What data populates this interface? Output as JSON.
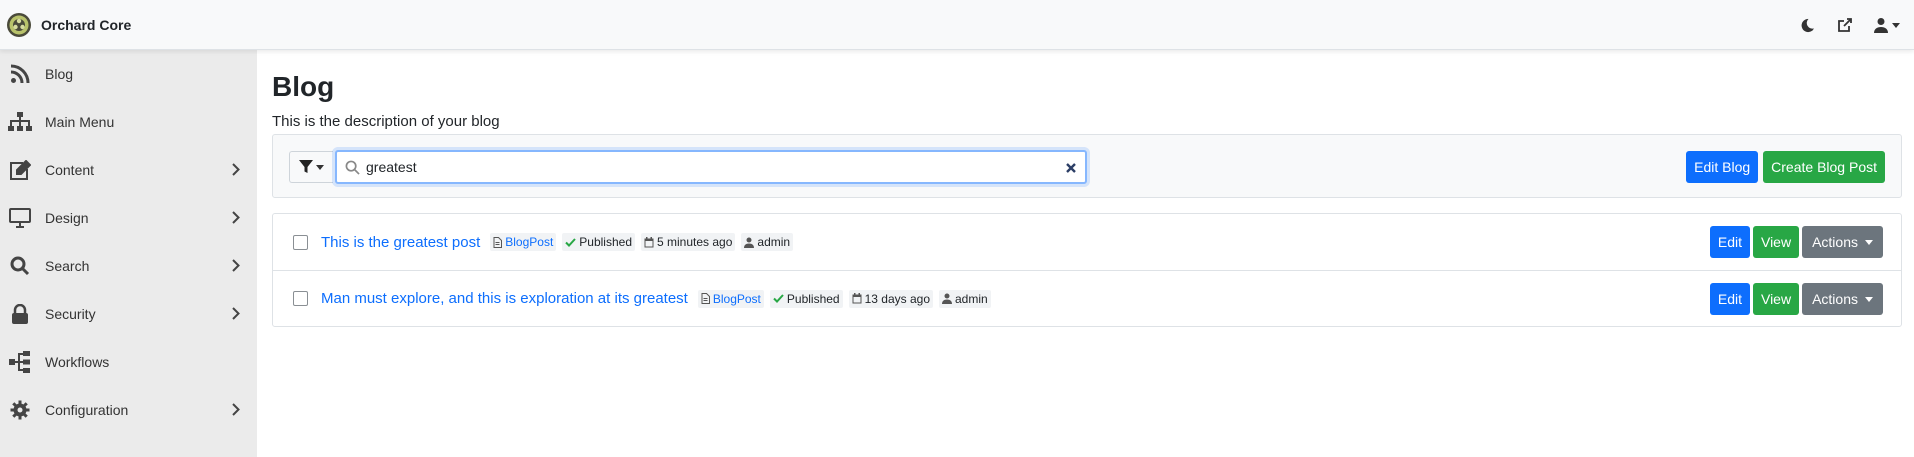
{
  "app": {
    "title": "Orchard Core"
  },
  "navbar": {
    "theme_icon": "moon-icon",
    "visit_site_icon": "external-link-icon",
    "user_icon": "user-icon"
  },
  "sidebar": {
    "items": [
      {
        "label": "Blog",
        "icon": "rss-icon",
        "has_children": false
      },
      {
        "label": "Main Menu",
        "icon": "sitemap-icon",
        "has_children": false
      },
      {
        "label": "Content",
        "icon": "edit-icon",
        "has_children": true
      },
      {
        "label": "Design",
        "icon": "monitor-icon",
        "has_children": true
      },
      {
        "label": "Search",
        "icon": "search-icon",
        "has_children": true
      },
      {
        "label": "Security",
        "icon": "lock-icon",
        "has_children": true
      },
      {
        "label": "Workflows",
        "icon": "workflow-icon",
        "has_children": false
      },
      {
        "label": "Configuration",
        "icon": "gear-icon",
        "has_children": true
      }
    ]
  },
  "main": {
    "title": "Blog",
    "description": "This is the description of your blog",
    "search": {
      "value": "greatest",
      "placeholder": ""
    },
    "edit_blog_label": "Edit Blog",
    "create_post_label": "Create Blog Post",
    "posts": [
      {
        "title": "This is the greatest post",
        "content_type": "BlogPost",
        "status": "Published",
        "modified": "5 minutes ago",
        "author": "admin",
        "edit_label": "Edit",
        "view_label": "View",
        "actions_label": "Actions"
      },
      {
        "title": "Man must explore, and this is exploration at its greatest",
        "content_type": "BlogPost",
        "status": "Published",
        "modified": "13 days ago",
        "author": "admin",
        "edit_label": "Edit",
        "view_label": "View",
        "actions_label": "Actions"
      }
    ]
  },
  "colors": {
    "primary": "#0d6efd",
    "success": "#28a745",
    "secondary": "#6c757d",
    "sidebar_bg": "#ebebeb",
    "navbar_bg": "#f8f9fa"
  }
}
